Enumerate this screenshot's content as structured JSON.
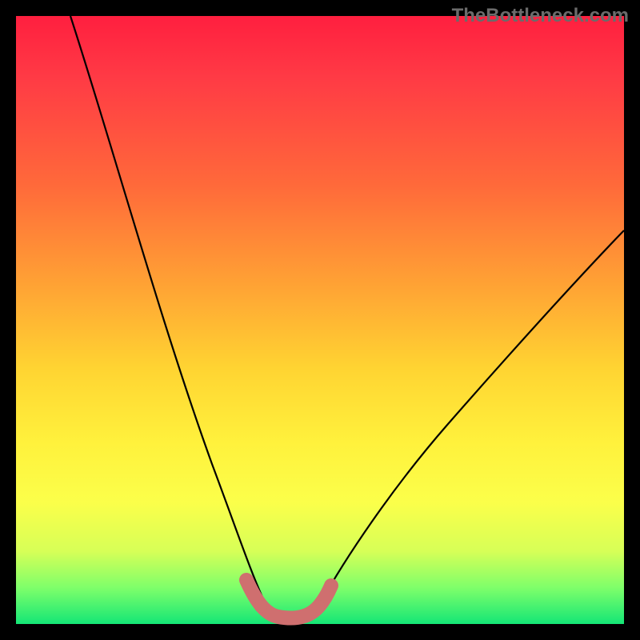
{
  "watermark": "TheBottleneck.com",
  "chart_data": {
    "type": "line",
    "title": "",
    "xlabel": "",
    "ylabel": "",
    "xlim": [
      0,
      100
    ],
    "ylim": [
      0,
      100
    ],
    "series": [
      {
        "name": "bottleneck-curve",
        "x": [
          9,
          12,
          16,
          20,
          24,
          28,
          31,
          34,
          36,
          38,
          40,
          42,
          44,
          46,
          48,
          51,
          55,
          60,
          66,
          73,
          80,
          88,
          96,
          100
        ],
        "y": [
          100,
          88,
          76,
          64,
          52,
          40,
          30,
          22,
          15,
          10,
          6,
          3,
          1.5,
          1.5,
          3,
          6,
          11,
          18,
          27,
          37,
          47,
          56,
          62,
          65
        ]
      }
    ],
    "annotations": [
      {
        "name": "curve-bottom-highlight",
        "color": "#d07a7a",
        "x_range": [
          37,
          50
        ],
        "y": 2
      }
    ],
    "gradient_stops": [
      {
        "pct": 0,
        "color": "#ff1f3f"
      },
      {
        "pct": 45,
        "color": "#ffa534"
      },
      {
        "pct": 70,
        "color": "#fff13c"
      },
      {
        "pct": 100,
        "color": "#14e676"
      }
    ]
  }
}
